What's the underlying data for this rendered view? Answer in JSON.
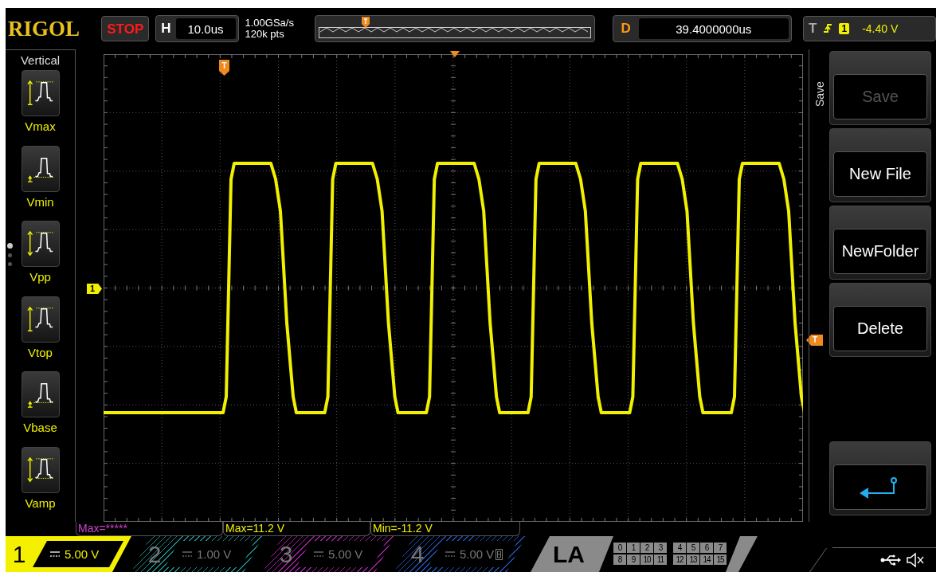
{
  "header": {
    "logo": "RIGOL",
    "run_state": "STOP",
    "horizontal": {
      "label": "H",
      "value": "10.0us"
    },
    "sample_rate": "1.00GSa/s",
    "memory_depth": "120k pts",
    "delay": {
      "label": "D",
      "value": "39.4000000us"
    },
    "trigger": {
      "label": "T",
      "source": "1",
      "level": "-4.40 V"
    }
  },
  "left_menu": {
    "title": "Vertical",
    "pages": [
      {
        "selected": true
      },
      {
        "selected": false
      },
      {
        "selected": false
      }
    ],
    "items": [
      {
        "label": "Vmax",
        "kind": "max"
      },
      {
        "label": "Vmin",
        "kind": "min"
      },
      {
        "label": "Vpp",
        "kind": "pp"
      },
      {
        "label": "Vtop",
        "kind": "top"
      },
      {
        "label": "Vbase",
        "kind": "base"
      },
      {
        "label": "Vamp",
        "kind": "amp"
      }
    ]
  },
  "grid": {
    "channel_marker": "1",
    "trigger_marker": "T",
    "level_marker": "T"
  },
  "right_menu": {
    "title": "Save",
    "items": [
      {
        "kind": "text",
        "label": "Save",
        "disabled": true
      },
      {
        "kind": "text",
        "label": "New File",
        "disabled": false
      },
      {
        "kind": "text",
        "label": "NewFolder",
        "disabled": false
      },
      {
        "kind": "text",
        "label": "Delete",
        "disabled": false
      },
      {
        "kind": "back"
      }
    ]
  },
  "measurements": [
    {
      "text": "Max=*****",
      "color": "#d040d0"
    },
    {
      "text": "Max=11.2 V",
      "color": "#f0f000"
    },
    {
      "text": "Min=-11.2 V",
      "color": "#f0f000"
    }
  ],
  "channels": [
    {
      "number": "1",
      "scale": "5.00 V",
      "on": true,
      "color": "#f5f000"
    },
    {
      "number": "2",
      "scale": "1.00 V",
      "on": false,
      "color": "#1c8a8a"
    },
    {
      "number": "3",
      "scale": "5.00 V",
      "on": false,
      "color": "#a020a0"
    },
    {
      "number": "4",
      "scale": "5.00 V",
      "on": false,
      "color": "#2050b0"
    }
  ],
  "la": {
    "label": "LA",
    "bits": [
      "0",
      "1",
      "2",
      "3",
      "4",
      "5",
      "6",
      "7",
      "8",
      "9",
      "10",
      "11",
      "12",
      "13",
      "14",
      "15"
    ]
  }
}
